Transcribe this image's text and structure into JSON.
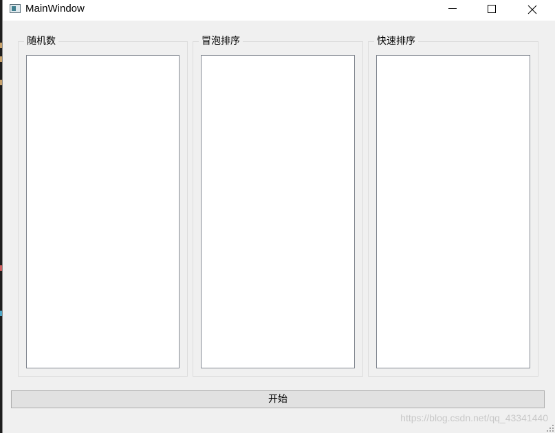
{
  "window": {
    "title": "MainWindow"
  },
  "icons": {
    "app": "app-window-icon",
    "minimize": "minimize-icon",
    "maximize": "maximize-icon",
    "close": "close-icon",
    "grip": "resize-grip-icon"
  },
  "groups": [
    {
      "title": "随机数",
      "items": []
    },
    {
      "title": "冒泡排序",
      "items": []
    },
    {
      "title": "快速排序",
      "items": []
    }
  ],
  "start_button": {
    "label": "开始"
  },
  "watermark": "https://blog.csdn.net/qq_43341440",
  "colors": {
    "window_bg": "#f0f0f0",
    "titlebar_bg": "#ffffff",
    "list_bg": "#ffffff",
    "button_bg": "#e1e1e1"
  }
}
